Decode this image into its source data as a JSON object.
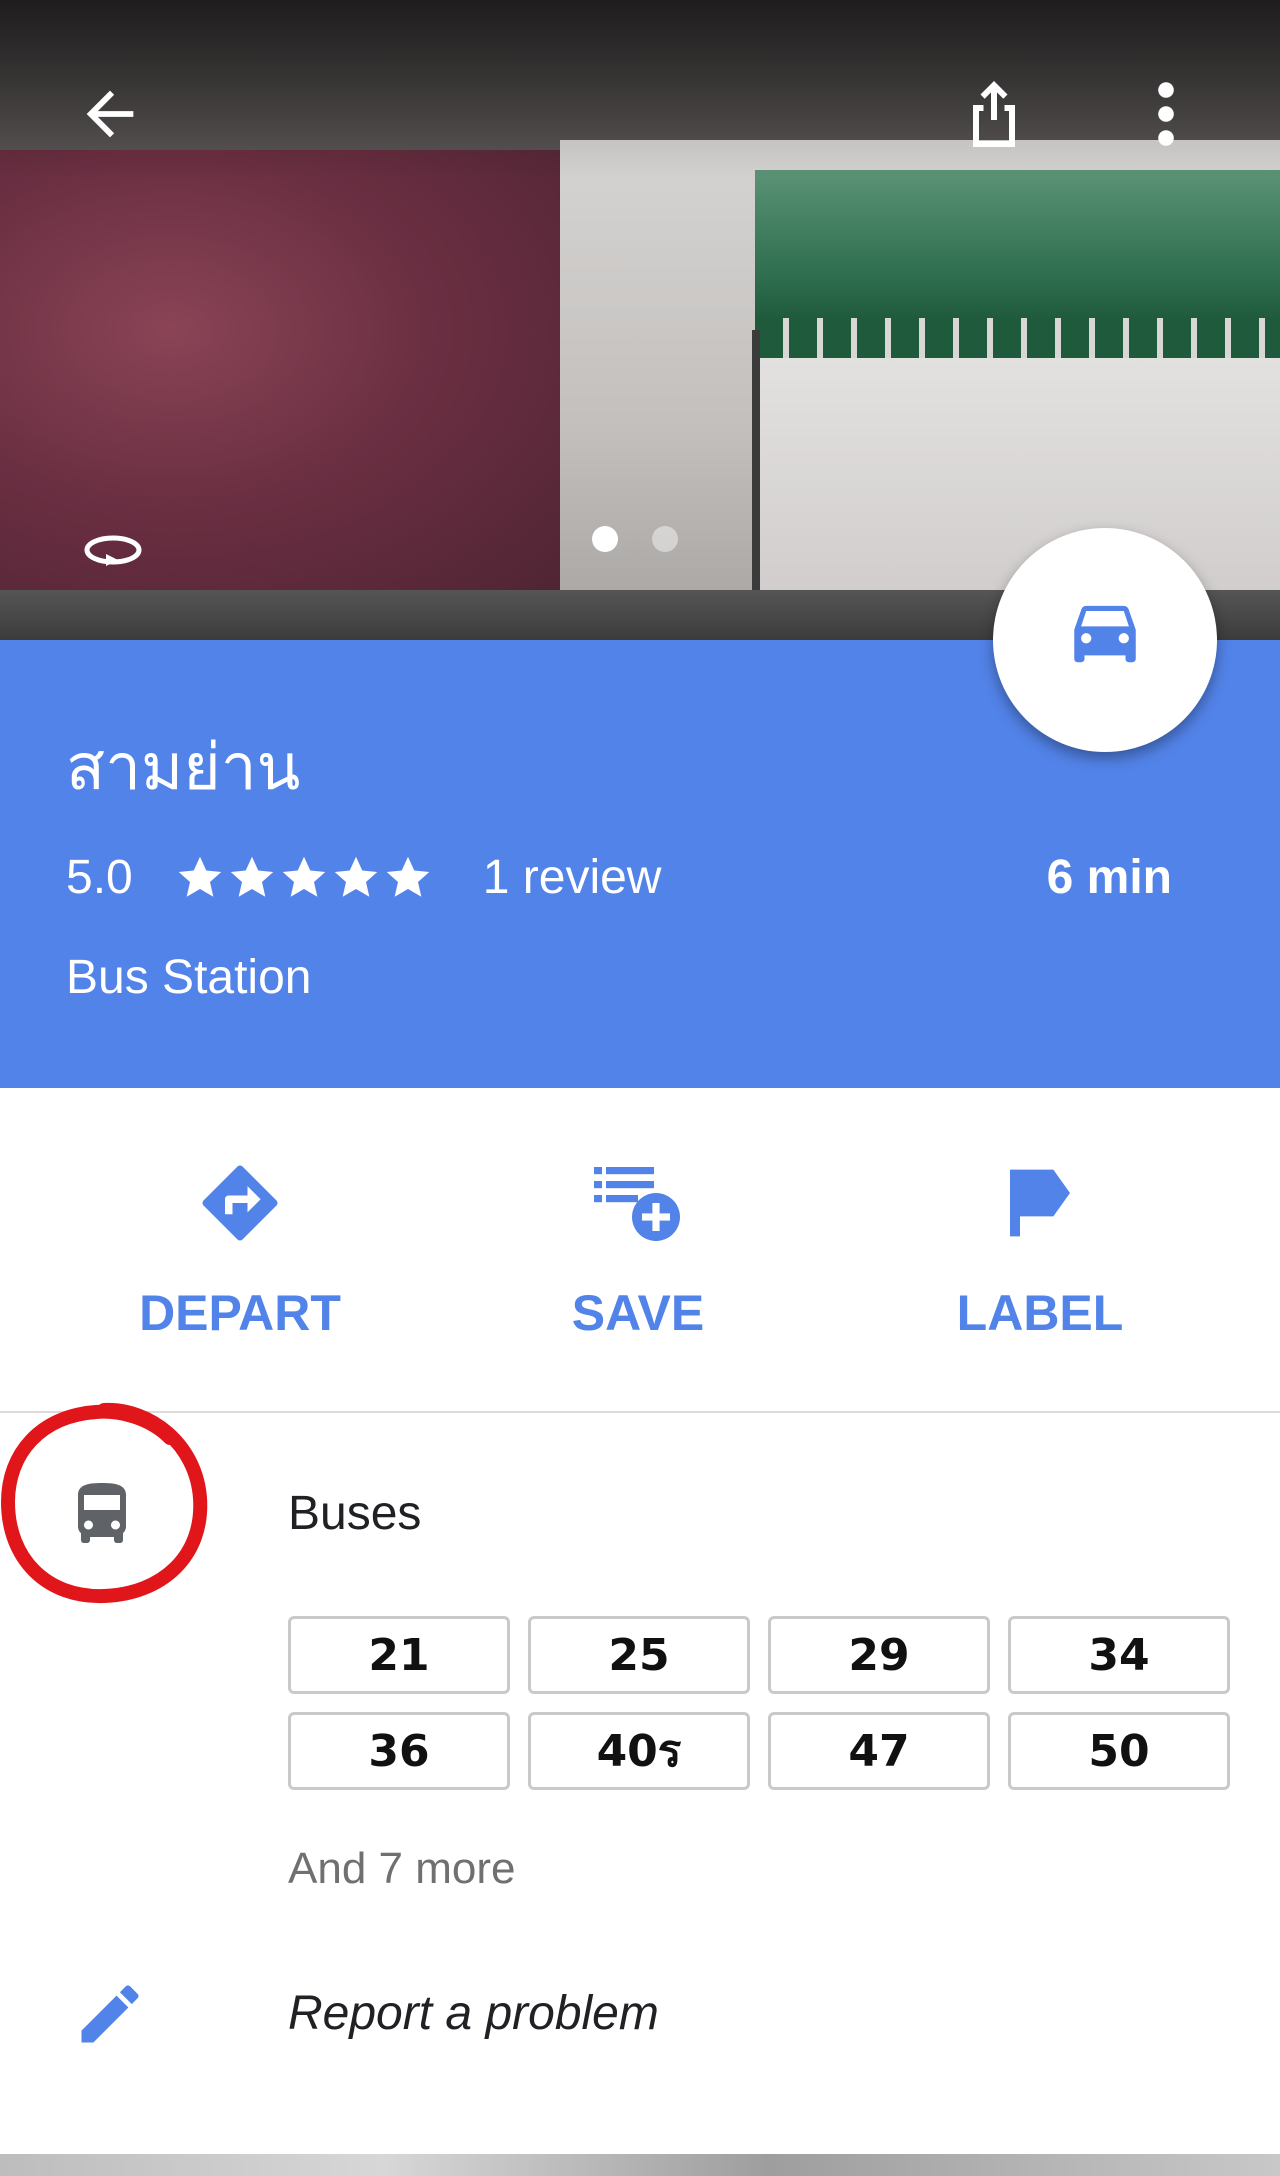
{
  "header": {
    "back_icon": "arrow-back-icon",
    "share_icon": "share-icon",
    "more_icon": "more-vert-icon",
    "rotate_icon": "rotate-360-icon",
    "photo_pages": 2,
    "photo_active_index": 0
  },
  "place": {
    "title": "สามย่าน",
    "rating_value": "5.0",
    "stars": 5,
    "review_count": "1 review",
    "duration": "6 min",
    "category": "Bus Station",
    "fab_icon": "car-icon"
  },
  "actions": [
    {
      "label": "DEPART",
      "icon": "directions-icon"
    },
    {
      "label": "SAVE",
      "icon": "playlist-add-icon"
    },
    {
      "label": "LABEL",
      "icon": "flag-icon"
    }
  ],
  "buses": {
    "heading": "Buses",
    "icon": "bus-icon",
    "routes": [
      "21",
      "25",
      "29",
      "34",
      "36",
      "40ร",
      "47",
      "50"
    ],
    "more": "And 7 more"
  },
  "report": {
    "label": "Report a problem",
    "icon": "edit-pencil-icon"
  },
  "colors": {
    "accent": "#5283e8",
    "annotation": "#e0161b"
  }
}
